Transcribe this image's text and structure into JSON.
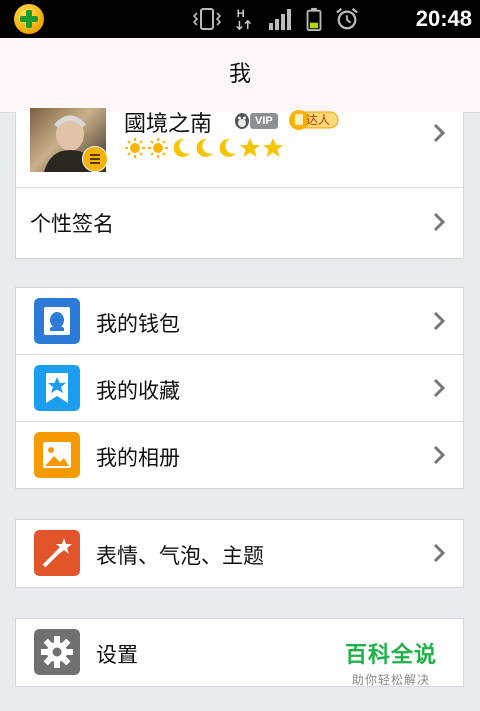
{
  "status_bar": {
    "time": "20:48",
    "network_label": "H"
  },
  "header": {
    "title": "我"
  },
  "profile": {
    "name": "國境之南",
    "vip_label": "VIP",
    "expert_label": "达人",
    "level_icons": [
      "sun",
      "sun",
      "moon",
      "moon",
      "moon",
      "star",
      "star"
    ]
  },
  "signature": {
    "label": "个性签名"
  },
  "group1": [
    {
      "label": "我的钱包",
      "icon": "wallet-icon",
      "color": "#2c7bd9"
    },
    {
      "label": "我的收藏",
      "icon": "favorites-icon",
      "color": "#1b9df0"
    },
    {
      "label": "我的相册",
      "icon": "album-icon",
      "color": "#f59b00"
    }
  ],
  "group2": [
    {
      "label": "表情、气泡、主题",
      "icon": "theme-icon",
      "color": "#e2552b"
    }
  ],
  "group3": [
    {
      "label": "设置",
      "icon": "settings-icon",
      "color": "#707070"
    }
  ],
  "watermark": {
    "main": "百科全说",
    "sub": "助你轻松解决"
  }
}
